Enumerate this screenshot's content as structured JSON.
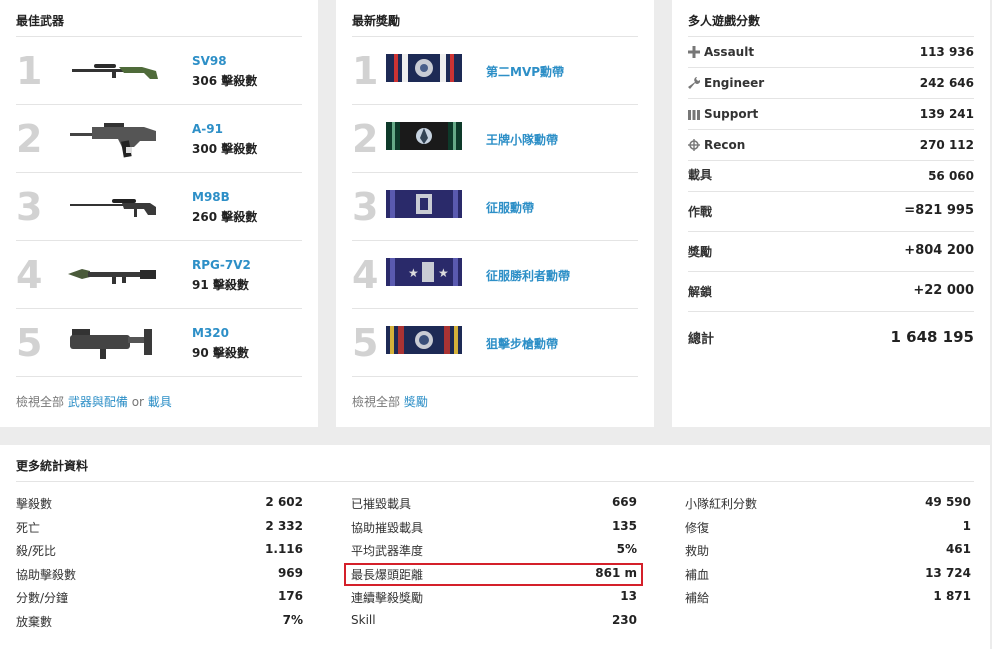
{
  "best_weapons": {
    "title": "最佳武器",
    "items": [
      {
        "rank": "1",
        "name": "SV98",
        "kills": "306 擊殺數"
      },
      {
        "rank": "2",
        "name": "A-91",
        "kills": "300 擊殺數"
      },
      {
        "rank": "3",
        "name": "M98B",
        "kills": "260 擊殺數"
      },
      {
        "rank": "4",
        "name": "RPG-7V2",
        "kills": "91 擊殺數"
      },
      {
        "rank": "5",
        "name": "M320",
        "kills": "90 擊殺數"
      }
    ],
    "footer_prefix": "檢視全部",
    "footer_link1": "武器與配備",
    "footer_or": "or",
    "footer_link2": "載具"
  },
  "latest_awards": {
    "title": "最新獎勵",
    "items": [
      {
        "rank": "1",
        "name": "第二MVP勳帶"
      },
      {
        "rank": "2",
        "name": "王牌小隊勳帶"
      },
      {
        "rank": "3",
        "name": "征服勳帶"
      },
      {
        "rank": "4",
        "name": "征服勝利者勳帶"
      },
      {
        "rank": "5",
        "name": "狙擊步槍勳帶"
      }
    ],
    "footer_prefix": "檢視全部",
    "footer_link": "獎勵"
  },
  "multiplayer_score": {
    "title": "多人遊戲分數",
    "rows": [
      {
        "label": "Assault",
        "value": "113 936",
        "icon": "plus-icon"
      },
      {
        "label": "Engineer",
        "value": "242 646",
        "icon": "wrench-icon"
      },
      {
        "label": "Support",
        "value": "139 241",
        "icon": "ammo-icon"
      },
      {
        "label": "Recon",
        "value": "270 112",
        "icon": "crosshair-icon"
      },
      {
        "label": "載具",
        "value": "56 060"
      },
      {
        "label": "作戰",
        "value": "=821 995"
      },
      {
        "label": "獎勵",
        "value": "+804 200"
      },
      {
        "label": "解鎖",
        "value": "+22 000"
      },
      {
        "label": "總計",
        "value": "1 648 195"
      }
    ]
  },
  "more_stats": {
    "title": "更多統計資料",
    "col1": [
      {
        "label": "擊殺數",
        "value": "2 602"
      },
      {
        "label": "死亡",
        "value": "2 332"
      },
      {
        "label": "殺/死比",
        "value": "1.116"
      },
      {
        "label": "協助擊殺數",
        "value": "969"
      },
      {
        "label": "分數/分鐘",
        "value": "176"
      },
      {
        "label": "放棄數",
        "value": "7%"
      }
    ],
    "col2": [
      {
        "label": "已摧毀載具",
        "value": "669"
      },
      {
        "label": "協助摧毀載具",
        "value": "135"
      },
      {
        "label": "平均武器準度",
        "value": "5%"
      },
      {
        "label": "最長爆頭距離",
        "value": "861 m"
      },
      {
        "label": "連續擊殺獎勵",
        "value": "13"
      },
      {
        "label": "Skill",
        "value": "230"
      }
    ],
    "col3": [
      {
        "label": "小隊紅利分數",
        "value": "49 590"
      },
      {
        "label": "修復",
        "value": "1"
      },
      {
        "label": "救助",
        "value": "461"
      },
      {
        "label": "補血",
        "value": "13 724"
      },
      {
        "label": "補給",
        "value": "1 871"
      }
    ]
  },
  "colors": {
    "link": "#2d8fc7",
    "highlight": "#d4202a",
    "rank_number": "#d2d2d2"
  }
}
